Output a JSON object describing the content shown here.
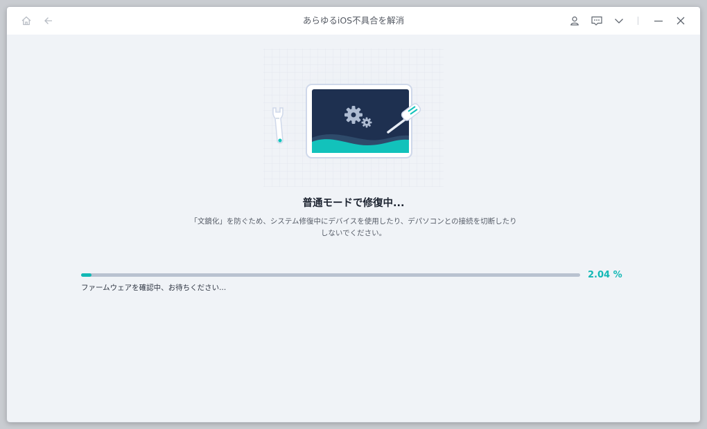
{
  "window": {
    "title": "あらゆるiOS不具合を解消"
  },
  "icons": {
    "home": "home-icon",
    "back": "back-arrow-icon",
    "account": "user-icon",
    "feedback": "chat-icon",
    "menu": "chevron-down-icon",
    "minimize": "minimize-icon",
    "close": "close-icon"
  },
  "main": {
    "heading": "普通モードで修復中...",
    "description_line1": "「文鏡化」を防ぐため、システム修復中にデバイスを使用したり、デパソコンとの接続を切断したり",
    "description_line2": "しないでください。"
  },
  "progress": {
    "value_percent": 2.04,
    "label": "2.04 %",
    "status": "ファームウェアを確認中、お待ちください..."
  },
  "colors": {
    "accent": "#12b8b5",
    "background": "#f0f3f7",
    "track": "#b9c2d0",
    "screen": "#1e3050"
  }
}
